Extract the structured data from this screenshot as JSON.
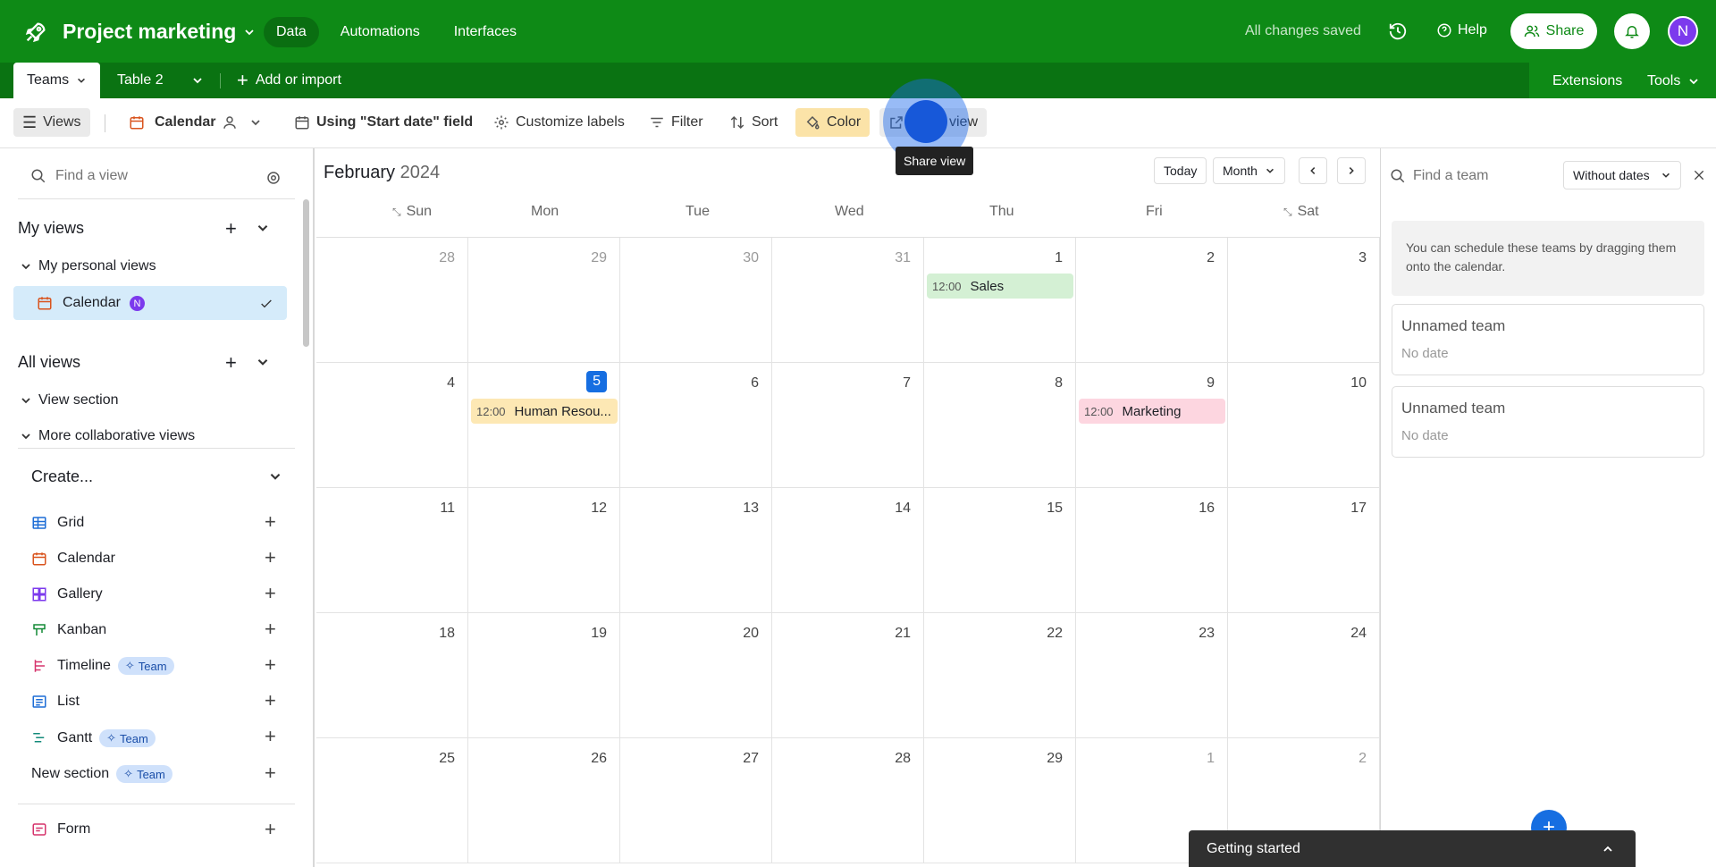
{
  "header": {
    "project_name": "Project marketing",
    "nav": [
      "Data",
      "Automations",
      "Interfaces"
    ],
    "saved_status": "All changes saved",
    "help_label": "Help",
    "share_label": "Share",
    "avatar_initial": "N",
    "brand_color": "#0e8a16"
  },
  "tabs": {
    "active_tab": "Teams",
    "second_tab": "Table 2",
    "add_or_import": "Add or import",
    "extensions": "Extensions",
    "tools": "Tools"
  },
  "toolbar": {
    "views_label": "Views",
    "view_name": "Calendar",
    "date_field": "Using \"Start date\" field",
    "customize_labels": "Customize labels",
    "filter": "Filter",
    "sort": "Sort",
    "color": "Color",
    "share_view_partial": "view",
    "tooltip": "Share view"
  },
  "sidebar": {
    "search_placeholder": "Find a view",
    "my_views": "My views",
    "my_personal_views": "My personal views",
    "active_view": "Calendar",
    "active_view_badge": "N",
    "all_views": "All views",
    "view_section": "View section",
    "more_collab": "More collaborative views",
    "create_label": "Create...",
    "create_items": [
      {
        "label": "Grid",
        "icon": "grid-icon"
      },
      {
        "label": "Calendar",
        "icon": "calendar-icon"
      },
      {
        "label": "Gallery",
        "icon": "gallery-icon"
      },
      {
        "label": "Kanban",
        "icon": "kanban-icon"
      },
      {
        "label": "Timeline",
        "icon": "timeline-icon",
        "badge": "Team"
      },
      {
        "label": "List",
        "icon": "list-icon"
      },
      {
        "label": "Gantt",
        "icon": "gantt-icon",
        "badge": "Team"
      }
    ],
    "new_section": "New section",
    "new_section_badge": "Team",
    "form_label": "Form"
  },
  "calendar": {
    "month": "February",
    "year": "2024",
    "today_label": "Today",
    "range_label": "Month",
    "day_headers": [
      "Sun",
      "Mon",
      "Tue",
      "Wed",
      "Thu",
      "Fri",
      "Sat"
    ],
    "weeks": [
      [
        "28",
        "29",
        "30",
        "31",
        "1",
        "2",
        "3"
      ],
      [
        "4",
        "5",
        "6",
        "7",
        "8",
        "9",
        "10"
      ],
      [
        "11",
        "12",
        "13",
        "14",
        "15",
        "16",
        "17"
      ],
      [
        "18",
        "19",
        "20",
        "21",
        "22",
        "23",
        "24"
      ],
      [
        "25",
        "26",
        "27",
        "28",
        "29",
        "1",
        "2"
      ]
    ],
    "today_date": "5",
    "events": [
      {
        "time": "12:00",
        "title": "Sales",
        "color": "#d4f0d4"
      },
      {
        "time": "12:00",
        "title": "Human Resou...",
        "color": "#fde8b4"
      },
      {
        "time": "12:00",
        "title": "Marketing",
        "color": "#fdd6e0"
      }
    ]
  },
  "right_panel": {
    "search_placeholder": "Find a team",
    "filter_label": "Without dates",
    "hint": "You can schedule these teams by dragging them onto the calendar.",
    "cards": [
      {
        "title": "Unnamed team",
        "sub": "No date"
      },
      {
        "title": "Unnamed team",
        "sub": "No date"
      }
    ]
  },
  "footer": {
    "getting_started": "Getting started"
  }
}
